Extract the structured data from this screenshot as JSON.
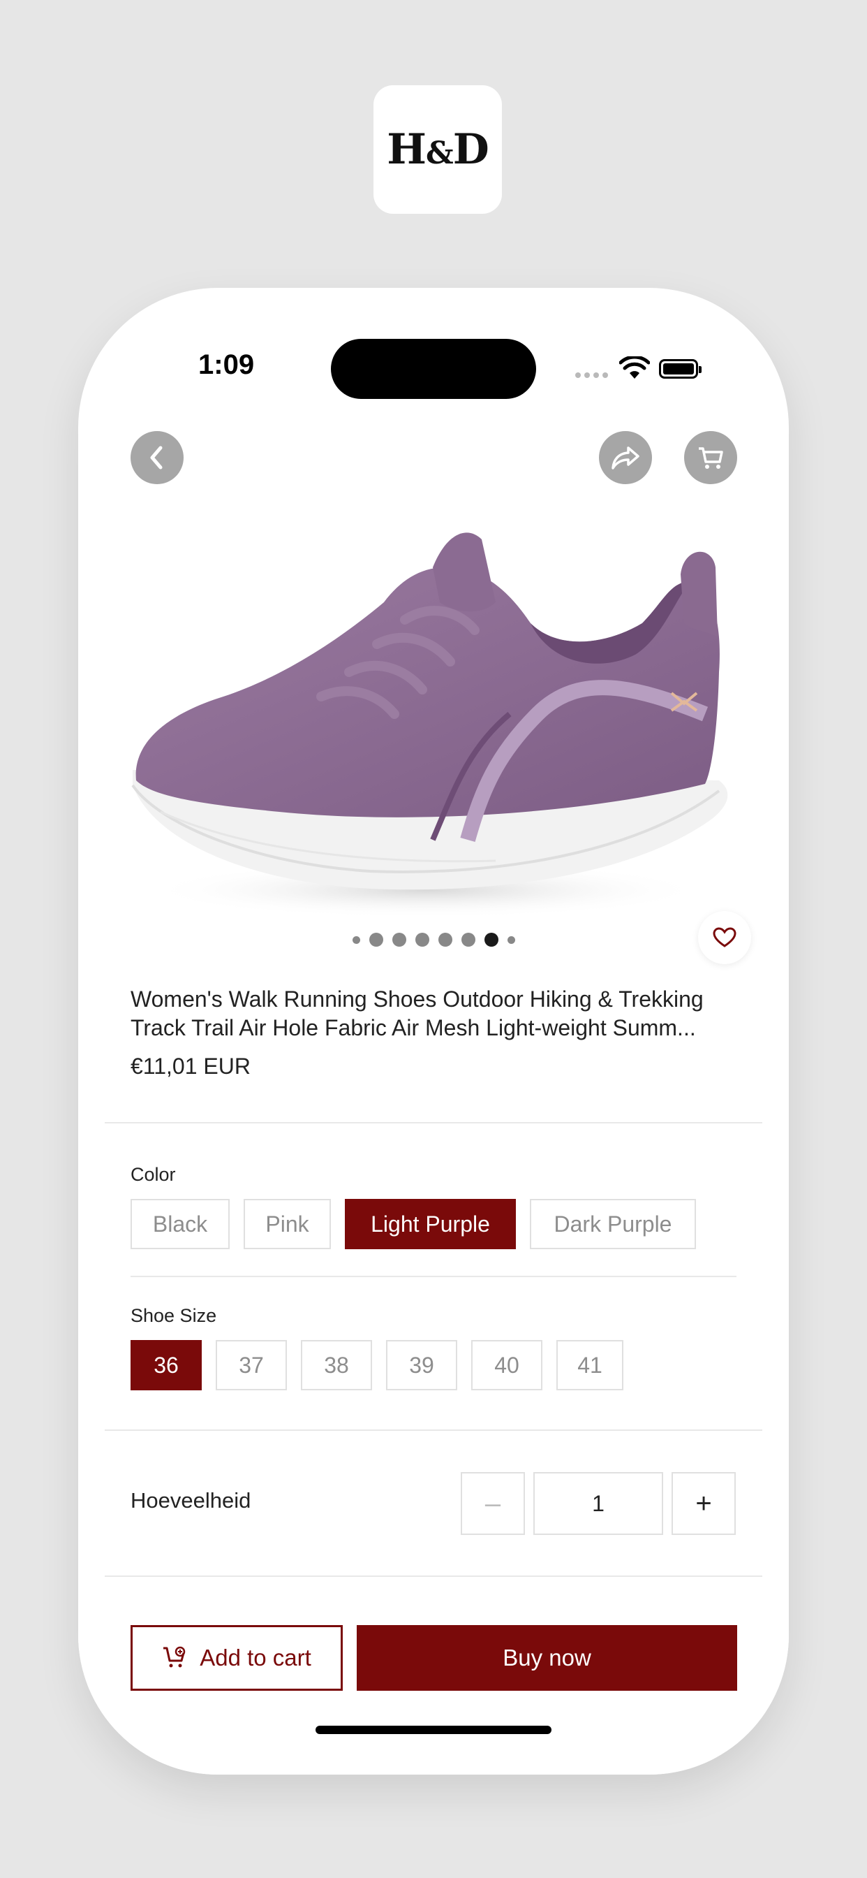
{
  "brand": {
    "logo_text_left": "H",
    "logo_text_amp": "&",
    "logo_text_right": "D"
  },
  "status_bar": {
    "time": "1:09"
  },
  "top_actions": {
    "back_icon": "chevron-left-icon",
    "share_icon": "share-icon",
    "cart_icon": "cart-icon"
  },
  "gallery": {
    "image_count": 8,
    "active_index": 6
  },
  "product": {
    "title_line1": "Women's Walk Running Shoes Outdoor Hiking & Trekking",
    "title_line2": "Track Trail Air Hole Fabric Air Mesh Light-weight Summ...",
    "price": "€11,01 EUR"
  },
  "color": {
    "label": "Color",
    "options": [
      "Black",
      "Pink",
      "Light Purple",
      "Dark Purple"
    ],
    "selected": "Light Purple"
  },
  "size": {
    "label": "Shoe Size",
    "options": [
      "36",
      "37",
      "38",
      "39",
      "40",
      "41"
    ],
    "selected": "36"
  },
  "quantity": {
    "label": "Hoeveelheid",
    "value": "1",
    "minus": "–",
    "plus": "+"
  },
  "actions": {
    "add_to_cart": "Add to cart",
    "buy_now": "Buy now"
  },
  "colors": {
    "accent": "#7a0a0a",
    "shoe": "#8c6a92",
    "sole": "#f4f4f4"
  }
}
